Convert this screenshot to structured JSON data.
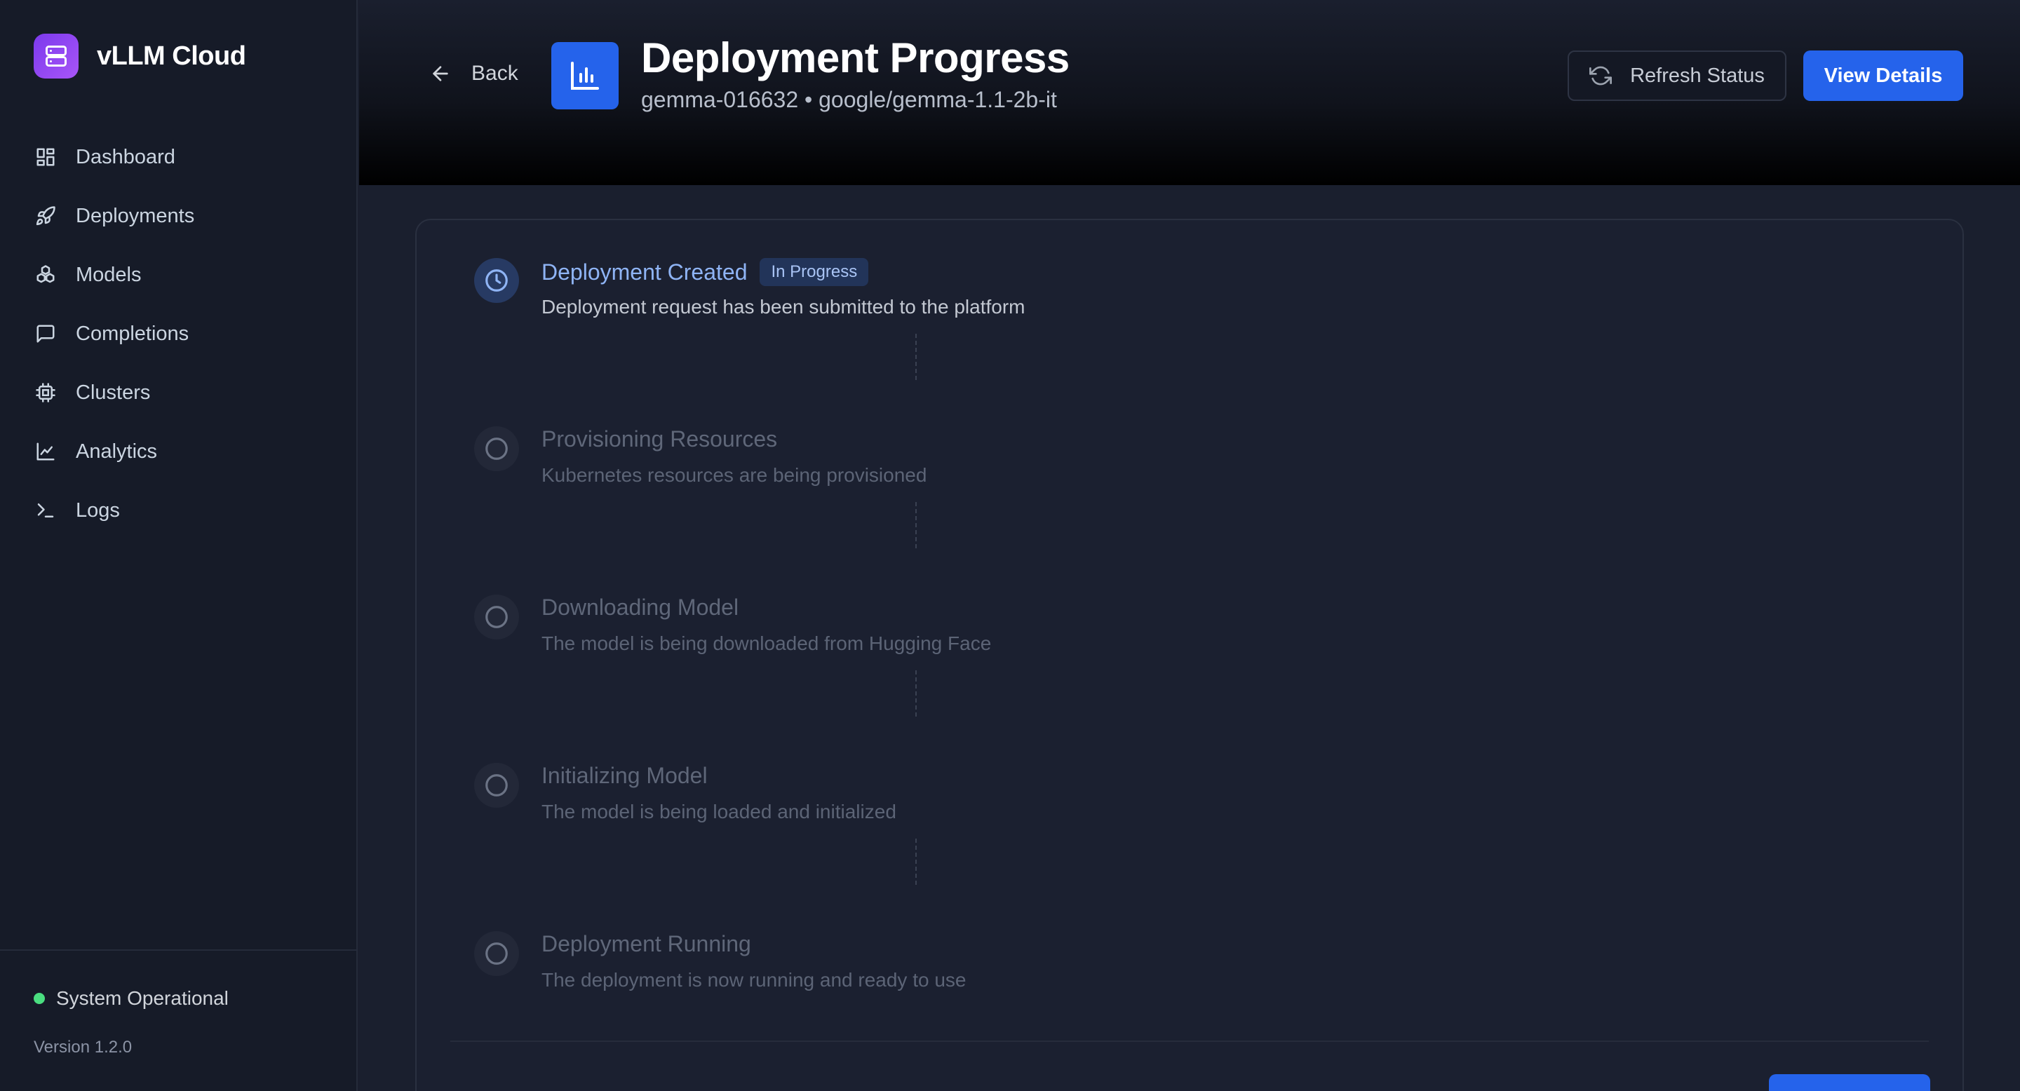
{
  "brand": {
    "name": "vLLM Cloud",
    "logo_icon": "server-icon",
    "accent": "#8b5cf6"
  },
  "sidebar": {
    "items": [
      {
        "label": "Dashboard",
        "icon": "dashboard-icon"
      },
      {
        "label": "Deployments",
        "icon": "rocket-icon"
      },
      {
        "label": "Models",
        "icon": "boxes-icon"
      },
      {
        "label": "Completions",
        "icon": "chat-icon"
      },
      {
        "label": "Clusters",
        "icon": "cpu-icon"
      },
      {
        "label": "Analytics",
        "icon": "line-chart-icon"
      },
      {
        "label": "Logs",
        "icon": "terminal-icon"
      }
    ],
    "status": {
      "label": "System Operational",
      "color": "#4ade80"
    },
    "version": "Version 1.2.0"
  },
  "header": {
    "back_label": "Back",
    "title": "Deployment Progress",
    "subtitle": "gemma-016632 • google/gemma-1.1-2b-it",
    "refresh_label": "Refresh Status",
    "details_label": "View Details",
    "primary_color": "#2563eb"
  },
  "steps": [
    {
      "title": "Deployment Created",
      "description": "Deployment request has been submitted to the platform",
      "status": "In Progress",
      "icon": "clock-icon"
    },
    {
      "title": "Provisioning Resources",
      "description": "Kubernetes resources are being provisioned",
      "status": "pending",
      "icon": "circle-icon"
    },
    {
      "title": "Downloading Model",
      "description": "The model is being downloaded from Hugging Face",
      "status": "pending",
      "icon": "circle-icon"
    },
    {
      "title": "Initializing Model",
      "description": "The model is being loaded and initialized",
      "status": "pending",
      "icon": "circle-icon"
    },
    {
      "title": "Deployment Running",
      "description": "The deployment is now running and ready to use",
      "status": "pending",
      "icon": "circle-icon"
    }
  ]
}
